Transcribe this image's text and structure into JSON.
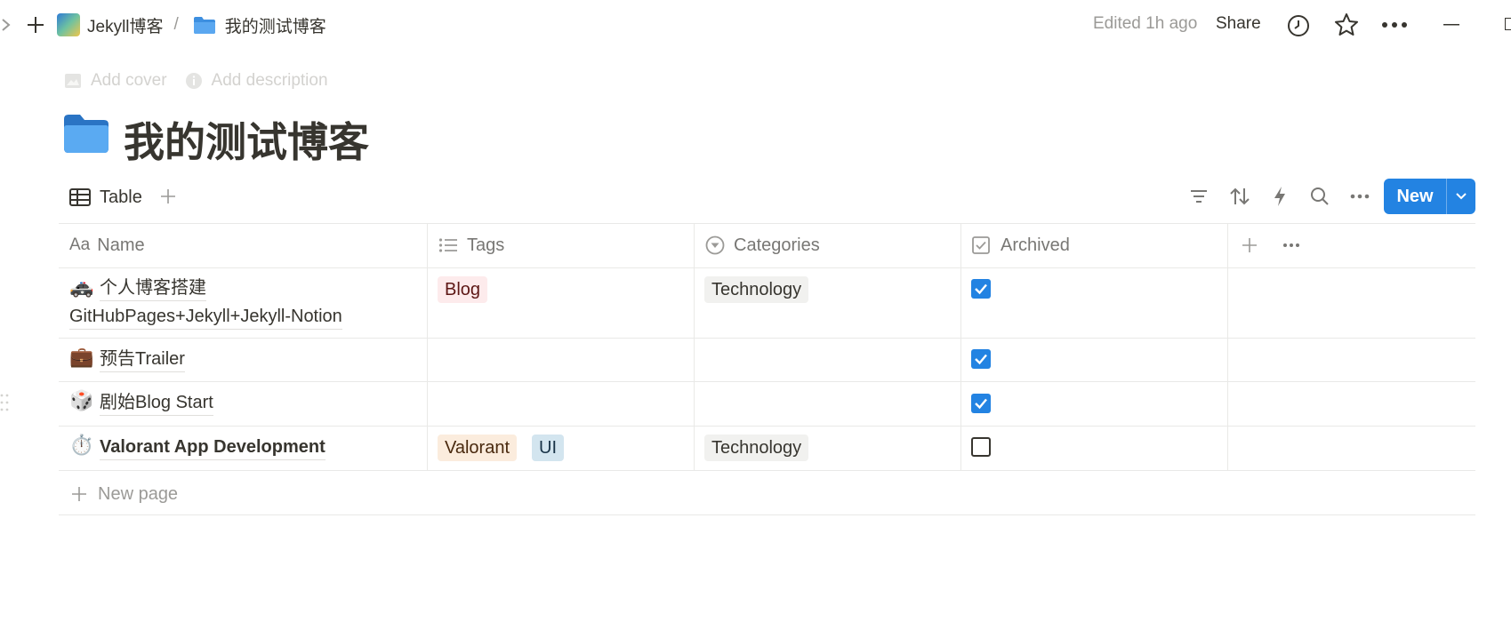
{
  "breadcrumb": {
    "workspace": "Jekyll博客",
    "separator": "/",
    "page": "我的测试博客"
  },
  "topbar": {
    "edited": "Edited 1h ago",
    "share": "Share"
  },
  "page_actions": {
    "add_cover": "Add cover",
    "add_description": "Add description"
  },
  "page": {
    "title": "我的测试博客"
  },
  "view": {
    "tab_label": "Table",
    "new_button": "New"
  },
  "table": {
    "columns": [
      "Name",
      "Tags",
      "Categories",
      "Archived"
    ],
    "column_icons": [
      "Aa",
      "list-icon",
      "select-icon",
      "checkbox-icon"
    ],
    "rows": [
      {
        "emoji": "🚓",
        "name_line1": "个人博客搭建",
        "name_line2": "GitHubPages+Jekyll+Jekyll-Notion",
        "tags": [
          "Blog"
        ],
        "category": "Technology",
        "archived": true
      },
      {
        "emoji": "💼",
        "name_line1": "预告Trailer",
        "name_line2": "",
        "tags": [],
        "category": "",
        "archived": true
      },
      {
        "emoji": "🎲",
        "name_line1": "剧始Blog Start",
        "name_line2": "",
        "tags": [],
        "category": "",
        "archived": true
      },
      {
        "emoji": "⏱️",
        "name_line1": "Valorant App Development",
        "name_line2": "",
        "tags": [
          "Valorant",
          "UI"
        ],
        "category": "Technology",
        "archived": false
      }
    ],
    "new_page": "New page"
  },
  "colors": {
    "accent": "#2383e2",
    "tag_blog": "#fdebec",
    "tag_valorant": "#fbecdd",
    "tag_ui": "#d3e5ef",
    "category_bg": "#f1f1ef"
  }
}
